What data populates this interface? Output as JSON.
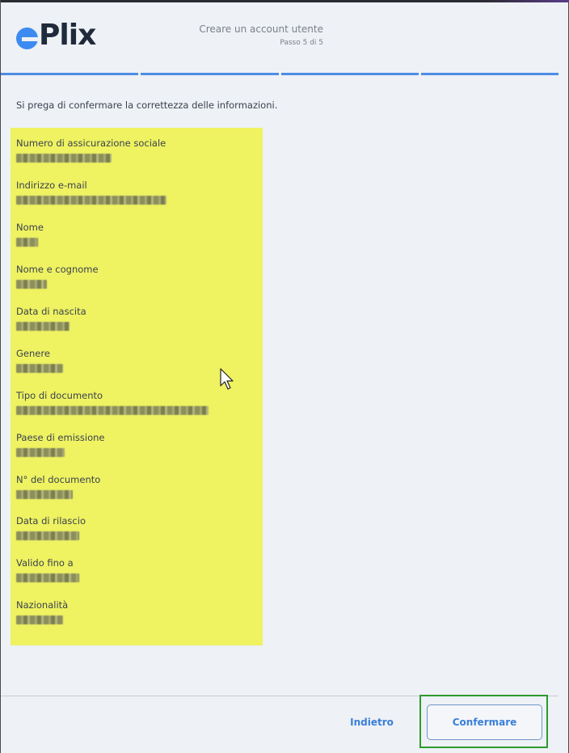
{
  "app": {
    "logo_text": "Plix"
  },
  "header": {
    "title": "Creare un account utente",
    "step": "Passo 5 di 5"
  },
  "intro_text": "Si prega di confermare la correttezza delle informazioni.",
  "fields": [
    {
      "label": "Numero di assicurazione sociale"
    },
    {
      "label": "Indirizzo e-mail"
    },
    {
      "label": "Nome"
    },
    {
      "label": "Nome e cognome"
    },
    {
      "label": "Data di nascita"
    },
    {
      "label": "Genere"
    },
    {
      "label": "Tipo di documento"
    },
    {
      "label": "Paese di emissione"
    },
    {
      "label": "N° del documento"
    },
    {
      "label": "Data di rilascio"
    },
    {
      "label": "Valido fino a"
    },
    {
      "label": "Nazionalità"
    }
  ],
  "buttons": {
    "back_label": "Indietro",
    "confirm_label": "Confermare"
  },
  "colors": {
    "accent": "#3a7fd9",
    "highlight": "#eff261",
    "focus_outline": "#2e9a2e"
  }
}
